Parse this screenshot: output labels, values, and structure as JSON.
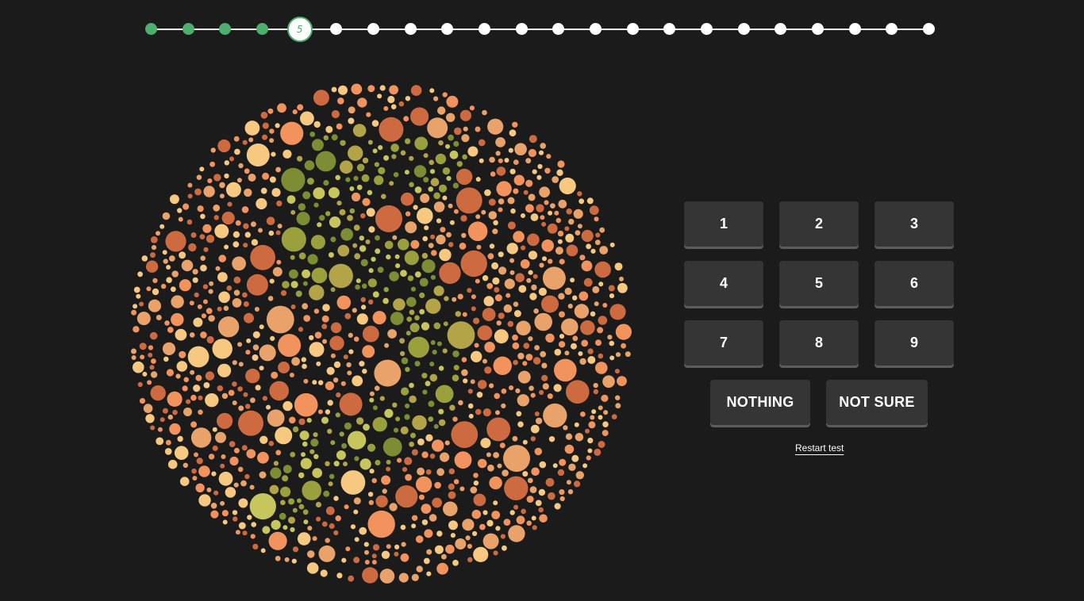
{
  "progress": {
    "total_steps": 22,
    "completed_steps": 4,
    "current_step_label": "5",
    "completed_color": "#4caf6e",
    "pending_color": "#ffffff"
  },
  "plate": {
    "background_dot_colors": [
      "#f7c980",
      "#f2935e",
      "#ce6a40",
      "#e8a26a"
    ],
    "figure_dot_colors": [
      "#c7c65d",
      "#7c8d33",
      "#b2a447",
      "#9aa13c"
    ]
  },
  "answers": {
    "buttons": [
      "1",
      "2",
      "3",
      "4",
      "5",
      "6",
      "7",
      "8",
      "9"
    ],
    "nothing_label": "NOTHING",
    "not_sure_label": "NOT SURE"
  },
  "restart_label": "Restart test",
  "colors": {
    "background": "#1b1b1b",
    "button": "#353535",
    "button_shadow": "#5c5c5c"
  }
}
